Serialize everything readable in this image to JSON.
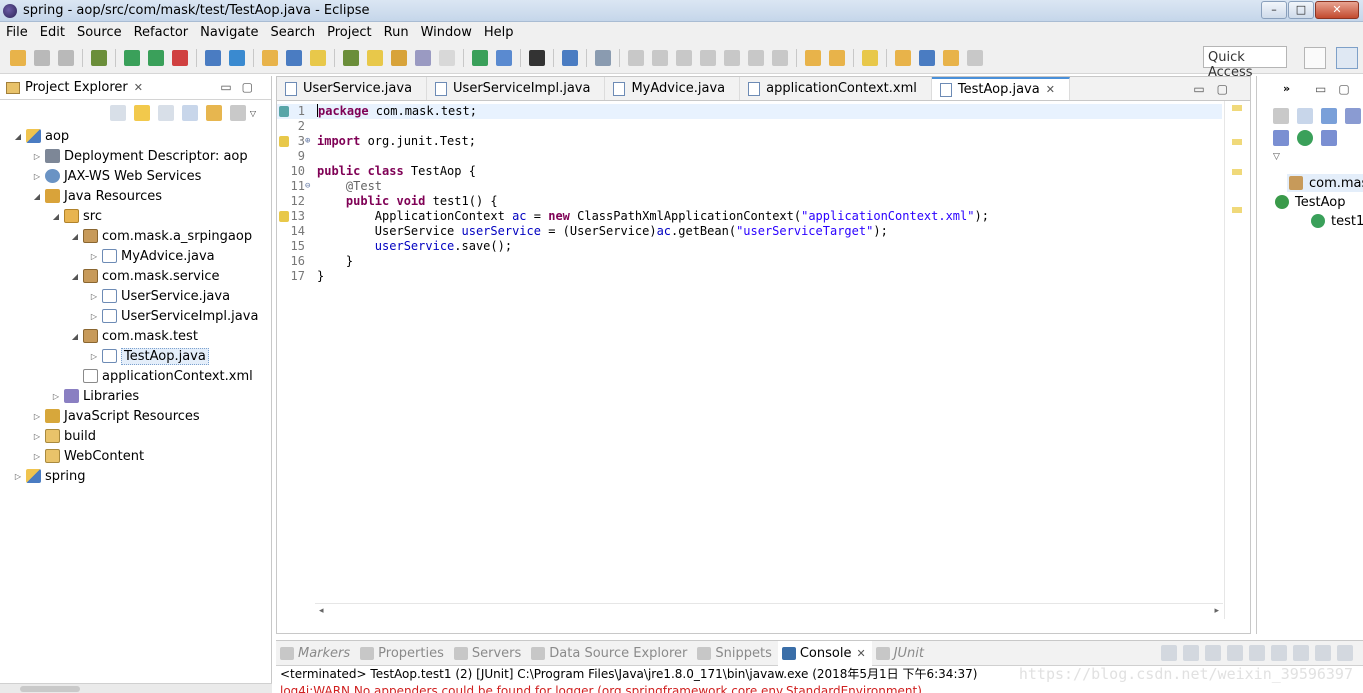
{
  "window": {
    "title": "spring - aop/src/com/mask/test/TestAop.java - Eclipse",
    "minimize": "–",
    "maximize": "□",
    "close": "✕"
  },
  "menu": [
    "File",
    "Edit",
    "Source",
    "Refactor",
    "Navigate",
    "Search",
    "Project",
    "Run",
    "Window",
    "Help"
  ],
  "toolbar": {
    "quick_access": "Quick Access"
  },
  "explorer": {
    "title": "Project Explorer",
    "close": "✕",
    "tree": [
      {
        "label": "aop",
        "depth": 0,
        "twisty": "◢",
        "icon": "proj"
      },
      {
        "label": "Deployment Descriptor: aop",
        "depth": 1,
        "twisty": "▷",
        "icon": "dd"
      },
      {
        "label": "JAX-WS Web Services",
        "depth": 1,
        "twisty": "▷",
        "icon": "ws"
      },
      {
        "label": "Java Resources",
        "depth": 1,
        "twisty": "◢",
        "icon": "jr"
      },
      {
        "label": "src",
        "depth": 2,
        "twisty": "◢",
        "icon": "src"
      },
      {
        "label": "com.mask.a_srpingaop",
        "depth": 3,
        "twisty": "◢",
        "icon": "pkg"
      },
      {
        "label": "MyAdvice.java",
        "depth": 4,
        "twisty": "▷",
        "icon": "java"
      },
      {
        "label": "com.mask.service",
        "depth": 3,
        "twisty": "◢",
        "icon": "pkg"
      },
      {
        "label": "UserService.java",
        "depth": 4,
        "twisty": "▷",
        "icon": "java"
      },
      {
        "label": "UserServiceImpl.java",
        "depth": 4,
        "twisty": "▷",
        "icon": "java"
      },
      {
        "label": "com.mask.test",
        "depth": 3,
        "twisty": "◢",
        "icon": "pkg"
      },
      {
        "label": "TestAop.java",
        "depth": 4,
        "twisty": "▷",
        "icon": "java",
        "selected": true
      },
      {
        "label": "applicationContext.xml",
        "depth": 3,
        "twisty": "",
        "icon": "xml"
      },
      {
        "label": "Libraries",
        "depth": 2,
        "twisty": "▷",
        "icon": "lib"
      },
      {
        "label": "JavaScript Resources",
        "depth": 1,
        "twisty": "▷",
        "icon": "js"
      },
      {
        "label": "build",
        "depth": 1,
        "twisty": "▷",
        "icon": "folder"
      },
      {
        "label": "WebContent",
        "depth": 1,
        "twisty": "▷",
        "icon": "folder"
      },
      {
        "label": "spring",
        "depth": 0,
        "twisty": "▷",
        "icon": "proj"
      }
    ]
  },
  "editor": {
    "tabs": [
      {
        "label": "UserService.java",
        "active": false
      },
      {
        "label": "UserServiceImpl.java",
        "active": false
      },
      {
        "label": "MyAdvice.java",
        "active": false
      },
      {
        "label": "applicationContext.xml",
        "active": false
      },
      {
        "label": "TestAop.java",
        "active": true
      }
    ],
    "tab_close": "✕",
    "lines": [
      {
        "num": "1",
        "marker": "blue",
        "fold": "",
        "current": true,
        "parts": [
          [
            "kw",
            "package"
          ],
          [
            "",
            " com.mask.test;"
          ]
        ]
      },
      {
        "num": "2",
        "marker": "",
        "fold": "",
        "parts": []
      },
      {
        "num": "3",
        "marker": "warn",
        "fold": "⊕",
        "parts": [
          [
            "kw",
            "import"
          ],
          [
            "",
            " org.junit.Test;"
          ]
        ]
      },
      {
        "num": "9",
        "marker": "",
        "fold": "",
        "parts": []
      },
      {
        "num": "10",
        "marker": "",
        "fold": "",
        "parts": [
          [
            "kw",
            "public class"
          ],
          [
            "",
            " TestAop {"
          ]
        ]
      },
      {
        "num": "11",
        "marker": "",
        "fold": "⊖",
        "parts": [
          [
            "",
            "    "
          ],
          [
            "ann",
            "@Test"
          ]
        ]
      },
      {
        "num": "12",
        "marker": "",
        "fold": "",
        "parts": [
          [
            "",
            "    "
          ],
          [
            "kw",
            "public void"
          ],
          [
            "",
            " test1() {"
          ]
        ]
      },
      {
        "num": "13",
        "marker": "warn",
        "fold": "",
        "parts": [
          [
            "",
            "        ApplicationContext "
          ],
          [
            "fld",
            "ac"
          ],
          [
            "",
            " = "
          ],
          [
            "kw",
            "new"
          ],
          [
            "",
            " ClassPathXmlApplicationContext("
          ],
          [
            "str",
            "\"applicationContext.xml\""
          ],
          [
            "",
            ");"
          ]
        ]
      },
      {
        "num": "14",
        "marker": "",
        "fold": "",
        "parts": [
          [
            "",
            "        UserService "
          ],
          [
            "fld",
            "userService"
          ],
          [
            "",
            " = (UserService)"
          ],
          [
            "fld",
            "ac"
          ],
          [
            "",
            ".getBean("
          ],
          [
            "str",
            "\"userServiceTarget\""
          ],
          [
            "",
            ");"
          ]
        ]
      },
      {
        "num": "15",
        "marker": "",
        "fold": "",
        "parts": [
          [
            "",
            "        "
          ],
          [
            "fld",
            "userService"
          ],
          [
            "",
            ".save();"
          ]
        ]
      },
      {
        "num": "16",
        "marker": "",
        "fold": "",
        "parts": [
          [
            "",
            "    }"
          ]
        ]
      },
      {
        "num": "17",
        "marker": "",
        "fold": "",
        "parts": [
          [
            "",
            "}"
          ]
        ]
      }
    ]
  },
  "outline": {
    "items": [
      {
        "label": "com.mask",
        "icon_color": "#c79a5a"
      },
      {
        "label": "TestAop",
        "icon_color": "#3a9a4a"
      },
      {
        "label": "test1",
        "icon_color": "#3aa05a"
      }
    ]
  },
  "console": {
    "tabs": [
      {
        "label": "Markers",
        "active": false,
        "italic": true
      },
      {
        "label": "Properties",
        "active": false
      },
      {
        "label": "Servers",
        "active": false
      },
      {
        "label": "Data Source Explorer",
        "active": false
      },
      {
        "label": "Snippets",
        "active": false
      },
      {
        "label": "Console",
        "active": true
      },
      {
        "label": "JUnit",
        "active": false,
        "italic": true
      }
    ],
    "status": "<terminated> TestAop.test1 (2) [JUnit] C:\\Program Files\\Java\\jre1.8.0_171\\bin\\javaw.exe (2018年5月1日 下午6:34:37)",
    "watermark": "https://blog.csdn.net/weixin_39596397",
    "output": "log4j:WARN No appenders could be found for logger (org.springframework.core.env.StandardEnvironment)."
  },
  "colors": {
    "keyword": "#7f0055",
    "string": "#2a00ff",
    "field": "#0000c0",
    "annotation": "#646464",
    "current_line": "#e8f2fe"
  }
}
